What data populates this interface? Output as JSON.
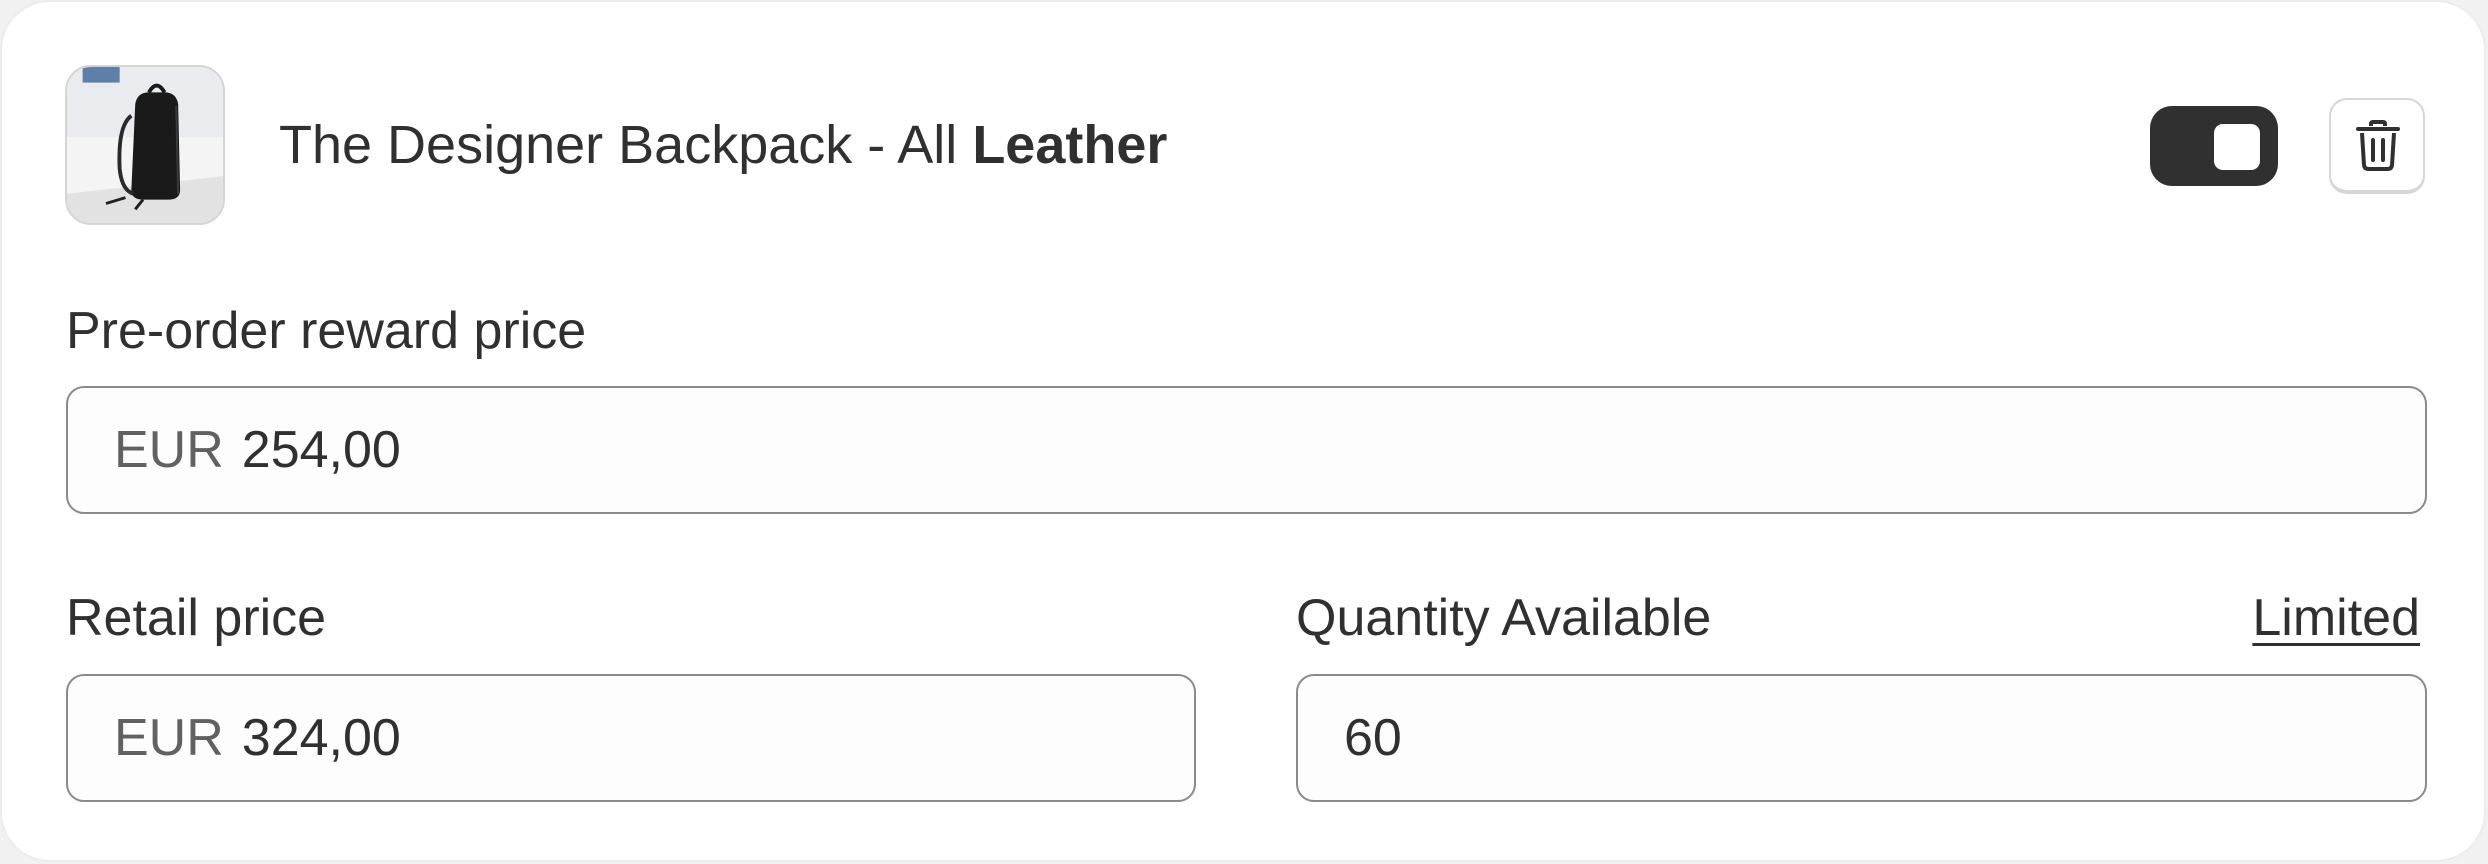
{
  "product": {
    "name_regular": "The Designer Backpack - All ",
    "name_bold": "Leather",
    "image_icon": "backpack-thumbnail"
  },
  "controls": {
    "toggle_state": "on",
    "delete_icon": "trash-icon"
  },
  "preorder": {
    "label": "Pre-order reward price",
    "currency": "EUR",
    "value": "254,00"
  },
  "retail": {
    "label": "Retail price",
    "currency": "EUR",
    "value": "324,00"
  },
  "quantity": {
    "label": "Quantity Available",
    "mode_link": "Limited",
    "value": "60"
  },
  "colors": {
    "text": "#303030",
    "muted": "#616161",
    "toggle_on": "#303030",
    "border": "#8a8a8a"
  }
}
